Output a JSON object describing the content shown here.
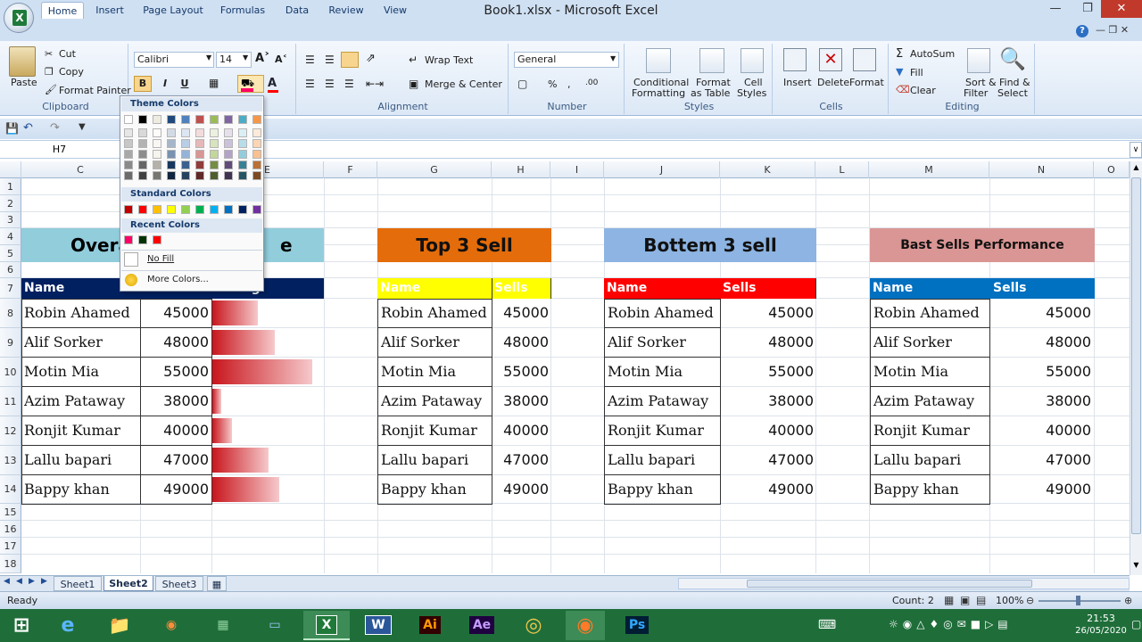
{
  "window": {
    "title": "Book1.xlsx - Microsoft Excel"
  },
  "tabs": [
    "Home",
    "Insert",
    "Page Layout",
    "Formulas",
    "Data",
    "Review",
    "View"
  ],
  "clipboard": {
    "paste": "Paste",
    "cut": "Cut",
    "copy": "Copy",
    "format_painter": "Format Painter",
    "label": "Clipboard"
  },
  "font": {
    "name": "Calibri",
    "size": "14",
    "bold": "B",
    "italic": "I",
    "underline": "U"
  },
  "alignment": {
    "wrap": "Wrap Text",
    "merge": "Merge & Center",
    "label": "Alignment"
  },
  "number": {
    "format": "General",
    "percent": "%",
    "comma": ",",
    "label": "Number"
  },
  "styles": {
    "conditional": "Conditional",
    "conditional2": "Formatting",
    "format_table": "Format",
    "format_table2": "as Table",
    "cell_styles": "Cell",
    "cell_styles2": "Styles",
    "label": "Styles"
  },
  "cells": {
    "insert": "Insert",
    "delete": "Delete",
    "format": "Format",
    "label": "Cells"
  },
  "editing": {
    "autosum": "AutoSum",
    "fill": "Fill",
    "clear": "Clear",
    "sort": "Sort &",
    "sort2": "Filter",
    "find": "Find &",
    "find2": "Select",
    "label": "Editing"
  },
  "namebox": "H7",
  "palette": {
    "theme_title": "Theme Colors",
    "standard_title": "Standard Colors",
    "recent_title": "Recent Colors",
    "no_fill": "No Fill",
    "more": "More Colors..."
  },
  "colors": {
    "theme_top": [
      "#ffffff",
      "#000000",
      "#eeece1",
      "#1f497d",
      "#4f81bd",
      "#c0504d",
      "#9bbb59",
      "#8064a2",
      "#4bacc6",
      "#f79646"
    ],
    "standard": [
      "#c00000",
      "#ff0000",
      "#ffc000",
      "#ffff00",
      "#92d050",
      "#00b050",
      "#00b0f0",
      "#0070c0",
      "#002060",
      "#7030a0"
    ],
    "recent": [
      "#ff0066",
      "#003300",
      "#ff0000"
    ]
  },
  "columns": [
    "C",
    "D",
    "E",
    "F",
    "G",
    "H",
    "I",
    "J",
    "K",
    "L",
    "M",
    "N",
    "O"
  ],
  "rows": [
    "1",
    "2",
    "3",
    "4",
    "5",
    "6",
    "7",
    "8",
    "9",
    "10",
    "11",
    "12",
    "13",
    "14",
    "15",
    "16",
    "17",
    "18"
  ],
  "tables": {
    "overall": {
      "title_left": "Overa",
      "title_right": "e",
      "h_name": "Name",
      "h_sells": "Sells",
      "h_rating": "Rating"
    },
    "top3": {
      "title": "Top 3 Sell",
      "h_name": "Name",
      "h_sells": "Sells"
    },
    "bottom3": {
      "title": "Bottem 3 sell",
      "h_name": "Name",
      "h_sells": "Sells"
    },
    "best": {
      "title": "Bast Sells Performance",
      "h_name": "Name",
      "h_sells": "Sells"
    }
  },
  "records": [
    {
      "name": "Robin Ahamed",
      "sells": "45000",
      "rating": 0.3
    },
    {
      "name": "Alif Sorker",
      "sells": "48000",
      "rating": 0.41
    },
    {
      "name": "Motin Mia",
      "sells": "55000",
      "rating": 0.66
    },
    {
      "name": "Azim Pataway",
      "sells": "38000",
      "rating": 0.06
    },
    {
      "name": "Ronjit Kumar",
      "sells": "40000",
      "rating": 0.13
    },
    {
      "name": "Lallu bapari",
      "sells": "47000",
      "rating": 0.37
    },
    {
      "name": "Bappy khan",
      "sells": "49000",
      "rating": 0.44
    }
  ],
  "sheets": [
    "Sheet1",
    "Sheet2",
    "Sheet3"
  ],
  "status": {
    "ready": "Ready",
    "count": "Count: 2",
    "zoom": "100%"
  },
  "clock": {
    "time": "21:53",
    "date": "26/05/2020"
  }
}
